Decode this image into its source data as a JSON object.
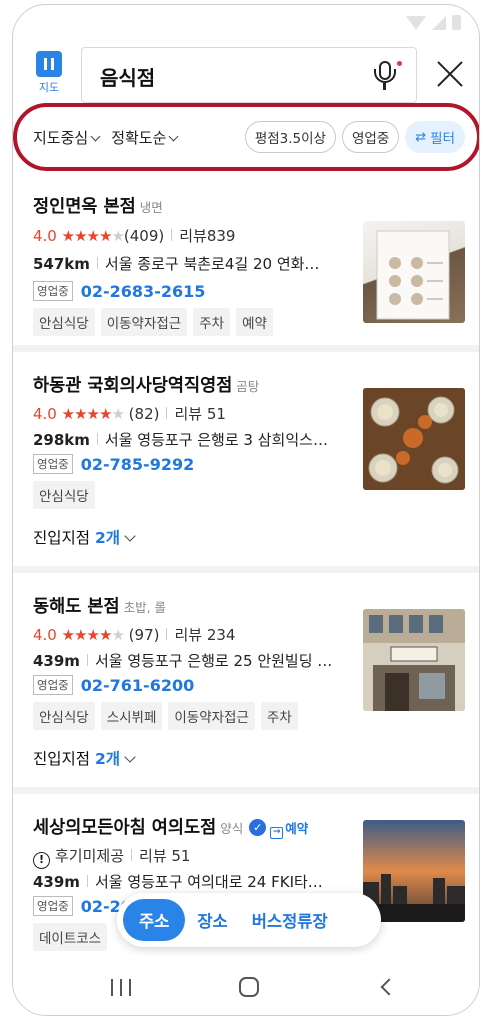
{
  "app": {
    "logo_label": "지도"
  },
  "search": {
    "query": "음식점"
  },
  "filters": {
    "sort_center": "지도중심",
    "sort_accuracy": "정확도순",
    "chips": [
      "평점3.5이상",
      "영업중"
    ],
    "filter_label": "필터"
  },
  "results": [
    {
      "name": "정인면옥 본점",
      "category": "냉면",
      "score": "4.0",
      "stars": 4,
      "rating_count": "(409)",
      "reviews": "리뷰839",
      "distance": "547km",
      "address": "서울 종로구 북촌로4길 20 연화…",
      "status": "영업중",
      "phone": "02-2683-2615",
      "tags": [
        "안심식당",
        "이동약자접근",
        "주차",
        "예약"
      ]
    },
    {
      "name": "하동관 국회의사당역직영점",
      "category": "곰탕",
      "score": "4.0",
      "stars": 4,
      "rating_count": "(82)",
      "reviews": "리뷰 51",
      "distance": "298km",
      "address": "서울 영등포구 은행로 3 삼희익스…",
      "status": "영업중",
      "phone": "02-785-9292",
      "tags": [
        "안심식당"
      ],
      "entry_label": "진입지점",
      "entry_count": "2개"
    },
    {
      "name": "동해도 본점",
      "category": "초밥, 롤",
      "score": "4.0",
      "stars": 4,
      "rating_count": "(97)",
      "reviews": "리뷰 234",
      "distance": "439m",
      "address": "서울 영등포구 은행로 25 안원빌딩 …",
      "status": "영업중",
      "phone": "02-761-6200",
      "tags": [
        "안심식당",
        "스시뷔페",
        "이동약자접근",
        "주차"
      ],
      "entry_label": "진입지점",
      "entry_count": "2개"
    },
    {
      "name": "세상의모든아침 여의도점",
      "category": "양식",
      "reserve_label": "예약",
      "no_rating": "후기미제공",
      "reviews": "리뷰 51",
      "distance": "439m",
      "address": "서울 영등포구 여의대로 24 FKI타…",
      "status": "영업중",
      "phone": "02-2055-4444",
      "tags": [
        "데이트코스"
      ]
    }
  ],
  "bottom_tabs": [
    "주소",
    "장소",
    "버스정류장"
  ],
  "colors": {
    "accent": "#2a84e8",
    "rating": "#e8452c",
    "highlight_ring": "#b0152a"
  }
}
